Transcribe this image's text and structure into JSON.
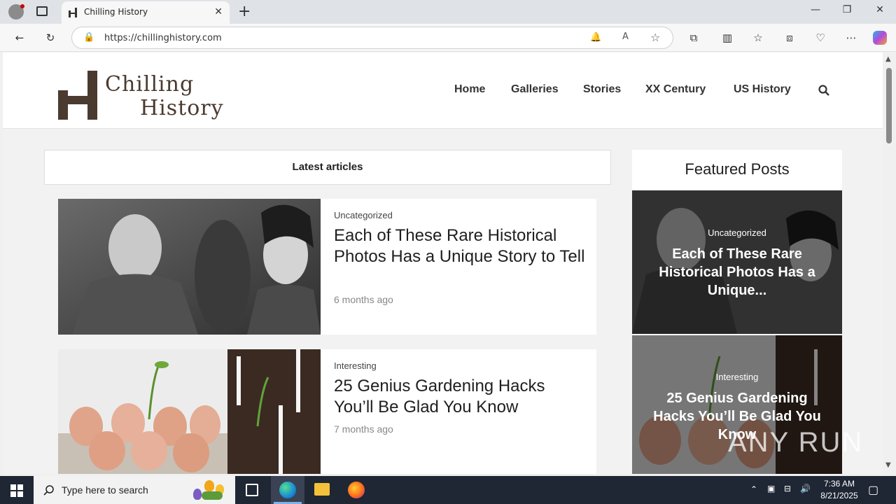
{
  "browser": {
    "tab_title": "Chilling History",
    "url": "https://chillinghistory.com"
  },
  "site": {
    "logo_line1": "Chilling",
    "logo_line2": "History",
    "nav": [
      "Home",
      "Galleries",
      "Stories",
      "XX Century",
      "US History"
    ]
  },
  "main": {
    "section_title": "Latest articles",
    "articles": [
      {
        "category": "Uncategorized",
        "title": "Each of These Rare Historical Photos Has a Unique Story to Tell",
        "time": "6 months ago"
      },
      {
        "category": "Interesting",
        "title": "25 Genius Gardening Hacks You’ll Be Glad You Know",
        "time": "7 months ago"
      }
    ]
  },
  "sidebar": {
    "title": "Featured Posts",
    "posts": [
      {
        "category": "Uncategorized",
        "title": "Each of These Rare Historical Photos Has a Unique..."
      },
      {
        "category": "Interesting",
        "title": "25 Genius Gardening Hacks You’ll Be Glad You Know"
      }
    ]
  },
  "taskbar": {
    "search_placeholder": "Type here to search",
    "time": "7:36 AM",
    "date": "8/21/2025"
  },
  "watermark": "ANY RUN",
  "colors": {
    "logo_brown": "#4b3a2f",
    "taskbar_bg": "#1f2634"
  }
}
